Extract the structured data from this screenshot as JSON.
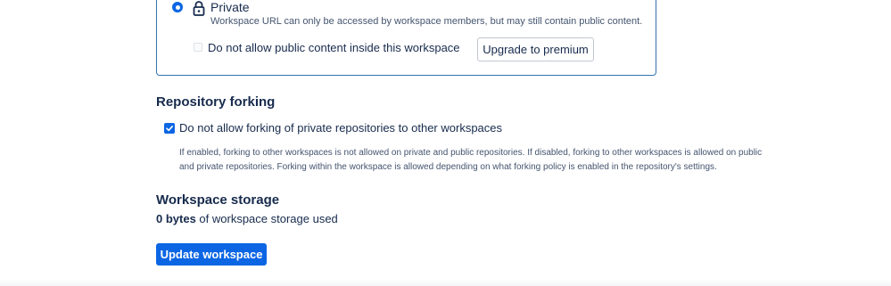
{
  "visibility": {
    "private_title": "Private",
    "private_description": "Workspace URL can only be accessed by workspace members, but may still contain public content.",
    "public_content_label": "Do not allow public content inside this workspace",
    "upgrade_button_label": "Upgrade to premium",
    "private_selected": true,
    "public_content_checked": false
  },
  "forking": {
    "heading": "Repository forking",
    "checkbox_label": "Do not allow forking of private repositories to other workspaces",
    "checkbox_checked": true,
    "help_text": "If enabled, forking to other workspaces is not allowed on private and public repositories. If disabled, forking to other workspaces is allowed on public and private repositories. Forking within the workspace is allowed depending on what forking policy is enabled in the repository's settings."
  },
  "storage": {
    "heading": "Workspace storage",
    "used_amount": "0 bytes",
    "used_suffix": " of workspace storage used"
  },
  "actions": {
    "update_button_label": "Update workspace"
  },
  "colors": {
    "accent": "#0c66e4",
    "card_border": "#3572b0",
    "text": "#172b4d",
    "subtle_text": "#44546f"
  },
  "icons": {
    "visibility": "lock-icon",
    "fork_checkbox": "checkmark-icon"
  }
}
